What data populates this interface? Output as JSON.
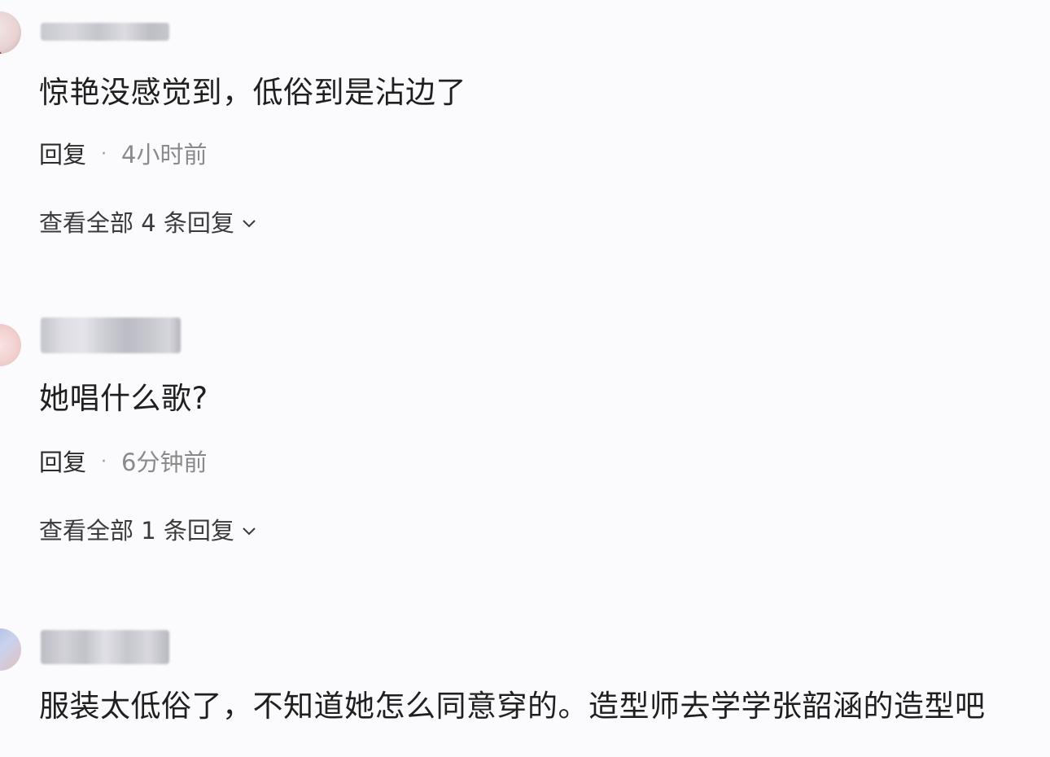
{
  "comments": [
    {
      "text": "惊艳没感觉到，低俗到是沾边了",
      "reply_label": "回复",
      "separator": "·",
      "time": "4小时前",
      "view_all": "查看全部 4 条回复"
    },
    {
      "text": "她唱什么歌?",
      "reply_label": "回复",
      "separator": "·",
      "time": "6分钟前",
      "view_all": "查看全部 1 条回复"
    },
    {
      "text": "服装太低俗了，不知道她怎么同意穿的。造型师去学学张韶涵的造型吧"
    }
  ],
  "icons": {
    "expand": "chevron-down-icon"
  },
  "colors": {
    "background": "#fbfbfd",
    "text": "#1f1f1f",
    "time": "#8a8a8a"
  }
}
